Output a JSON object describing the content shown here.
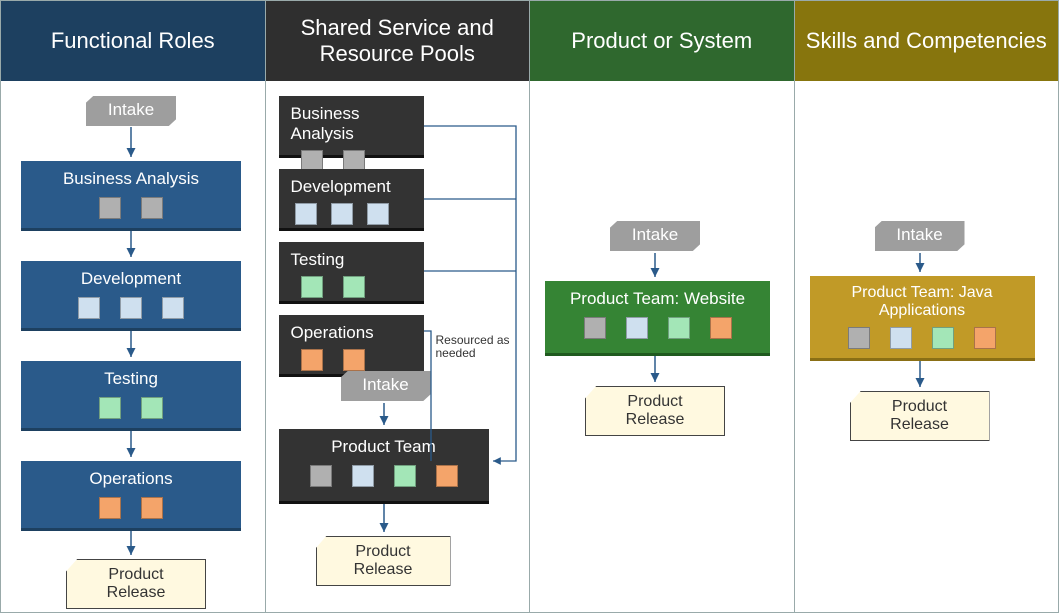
{
  "columns": [
    {
      "title": "Functional Roles"
    },
    {
      "title": "Shared Service and Resource Pools"
    },
    {
      "title": "Product or System"
    },
    {
      "title": "Skills and Competencies"
    }
  ],
  "labels": {
    "intake": "Intake",
    "release": "Product Release",
    "resourced": "Resourced as needed",
    "ba": "Business Analysis",
    "dev": "Development",
    "test": "Testing",
    "ops": "Operations",
    "pteam": "Product Team",
    "pteam_web": "Product Team: Website",
    "pteam_java": "Product Team: Java Applications"
  }
}
